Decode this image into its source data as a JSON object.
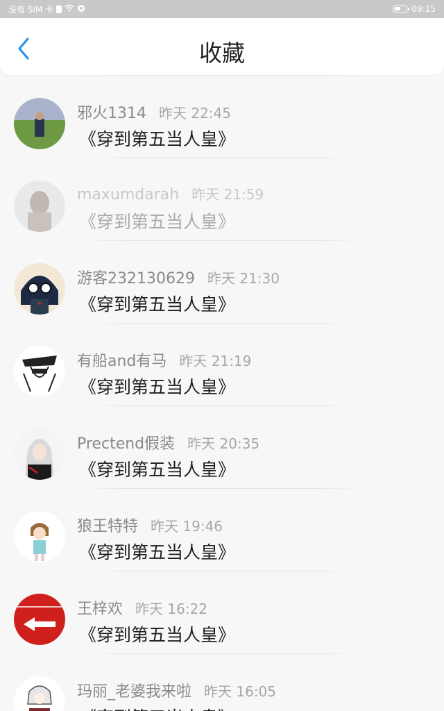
{
  "status_bar": {
    "carrier": "没有 SIM 卡",
    "time": "09:15"
  },
  "header": {
    "title": "收藏",
    "back_icon": "chevron-left-icon",
    "accent_color": "#2b8ff0"
  },
  "favorites": [
    {
      "name": "邪火1314",
      "time": "昨天 22:45",
      "title": "《穿到第五当人皇》"
    },
    {
      "name": "maxumdarah",
      "time": "昨天 21:59",
      "title": "《穿到第五当人皇》"
    },
    {
      "name": "游客232130629",
      "time": "昨天 21:30",
      "title": "《穿到第五当人皇》"
    },
    {
      "name": "有船and有马",
      "time": "昨天 21:19",
      "title": "《穿到第五当人皇》"
    },
    {
      "name": "Prectend假装",
      "time": "昨天 20:35",
      "title": "《穿到第五当人皇》"
    },
    {
      "name": "狼王特特",
      "time": "昨天 19:46",
      "title": "《穿到第五当人皇》"
    },
    {
      "name": "王梓欢",
      "time": "昨天 16:22",
      "title": "《穿到第五当人皇》"
    },
    {
      "name": "玛丽_老婆我来啦",
      "time": "昨天 16:05",
      "title": "《穿到第五当人皇》"
    }
  ]
}
